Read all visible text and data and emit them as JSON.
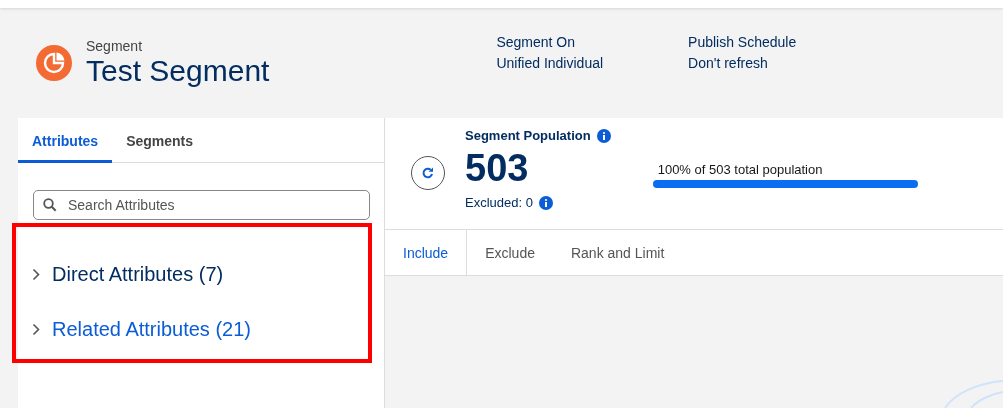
{
  "header": {
    "object_type": "Segment",
    "title": "Test Segment",
    "fields": [
      {
        "label": "Segment On",
        "value": "Unified Individual"
      },
      {
        "label": "Publish Schedule",
        "value": "Don't refresh"
      }
    ]
  },
  "sidebar": {
    "tabs": [
      {
        "label": "Attributes",
        "selected": true
      },
      {
        "label": "Segments",
        "selected": false
      }
    ],
    "search": {
      "placeholder": "Search Attributes"
    },
    "annotated": true,
    "tree": [
      {
        "label": "Direct Attributes (7)",
        "expanded": false,
        "hovered": false
      },
      {
        "label": "Related Attributes (21)",
        "expanded": false,
        "hovered": true
      }
    ]
  },
  "population": {
    "title": "Segment Population",
    "count": "503",
    "excluded": "Excluded: 0",
    "bar_label": "100% of 503 total population",
    "level": 1
  },
  "tabs": [
    {
      "label": "Include",
      "selected": true
    },
    {
      "label": "Exclude",
      "selected": false
    },
    {
      "label": "Rank and Limit",
      "selected": false
    }
  ]
}
